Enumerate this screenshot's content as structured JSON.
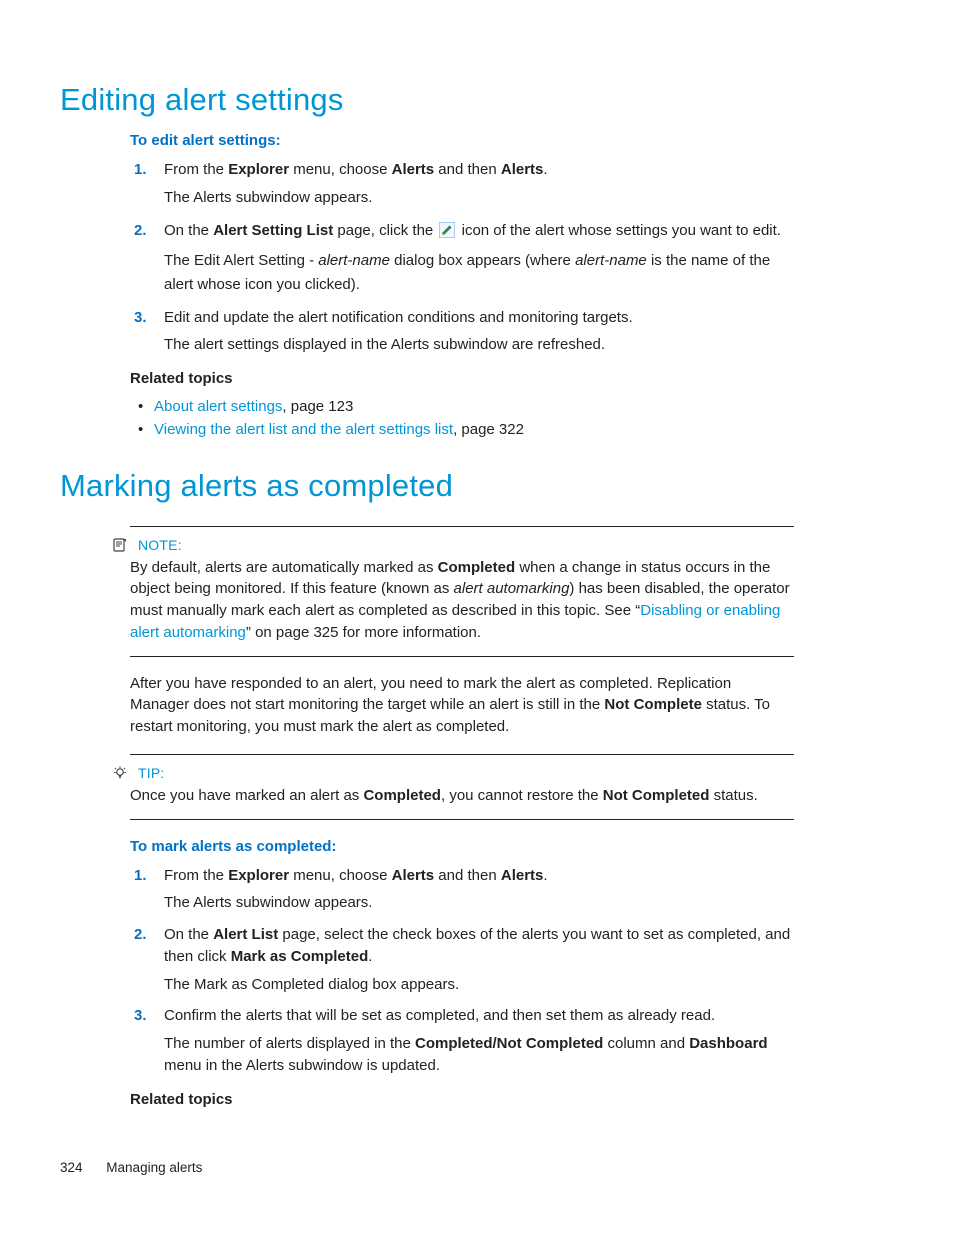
{
  "section1": {
    "heading": "Editing alert settings",
    "lead": "To edit alert settings:",
    "steps": [
      {
        "p1a": "From the ",
        "b1": "Explorer",
        "p1b": " menu, choose ",
        "b2": "Alerts",
        "p1c": " and then ",
        "b3": "Alerts",
        "p1d": ".",
        "sub": "The Alerts subwindow appears."
      },
      {
        "p1a": "On the ",
        "b1": "Alert Setting List",
        "p1b": " page, click the ",
        "p1c": " icon of the alert whose settings you want to edit.",
        "sub_a": "The Edit Alert Setting - ",
        "sub_i": "alert-name",
        "sub_b": " dialog box appears (where ",
        "sub_i2": "alert-name",
        "sub_c": " is the name of the alert whose icon you clicked)."
      },
      {
        "p1": "Edit and update the alert notification conditions and monitoring targets.",
        "sub": "The alert settings displayed in the Alerts subwindow are refreshed."
      }
    ],
    "related_label": "Related topics",
    "related": [
      {
        "link": "About alert settings",
        "rest": ", page 123"
      },
      {
        "link": "Viewing the alert list and the alert settings list",
        "rest": ", page 322"
      }
    ]
  },
  "section2": {
    "heading": "Marking alerts as completed",
    "note_label": "NOTE:",
    "note_a": "By default, alerts are automatically marked as ",
    "note_b1": "Completed",
    "note_b": " when a change in status occurs in the object being monitored. If this feature (known as ",
    "note_i": "alert automarking",
    "note_c": ") has been disabled, the operator must manually mark each alert as completed as described in this topic. See “",
    "note_link": "Disabling or enabling alert automarking",
    "note_d": "” on page 325 for more information.",
    "para_a": "After you have responded to an alert, you need to mark the alert as completed. Replication Manager does not start monitoring the target while an alert is still in the ",
    "para_b1": "Not Complete",
    "para_b": " status. To restart monitoring, you must mark the alert as completed.",
    "tip_label": "TIP:",
    "tip_a": "Once you have marked an alert as ",
    "tip_b1": "Completed",
    "tip_b": ", you cannot restore the ",
    "tip_b2": "Not Completed",
    "tip_c": " status.",
    "lead": "To mark alerts as completed:",
    "steps": [
      {
        "p1a": "From the ",
        "b1": "Explorer",
        "p1b": " menu, choose ",
        "b2": "Alerts",
        "p1c": " and then ",
        "b3": "Alerts",
        "p1d": ".",
        "sub": "The Alerts subwindow appears."
      },
      {
        "p1a": "On the ",
        "b1": "Alert List",
        "p1b": " page, select the check boxes of the alerts you want to set as completed, and then click ",
        "b2": "Mark as Completed",
        "p1c": ".",
        "sub": "The Mark as Completed dialog box appears."
      },
      {
        "p1": "Confirm the alerts that will be set as completed, and then set them as already read.",
        "sub_a": "The number of alerts displayed in the ",
        "sub_b1": "Completed/Not Completed",
        "sub_b": " column and ",
        "sub_b2": "Dashboard",
        "sub_c": " menu in the Alerts subwindow is updated."
      }
    ],
    "related_label": "Related topics"
  },
  "footer": {
    "page": "324",
    "title": "Managing alerts"
  }
}
